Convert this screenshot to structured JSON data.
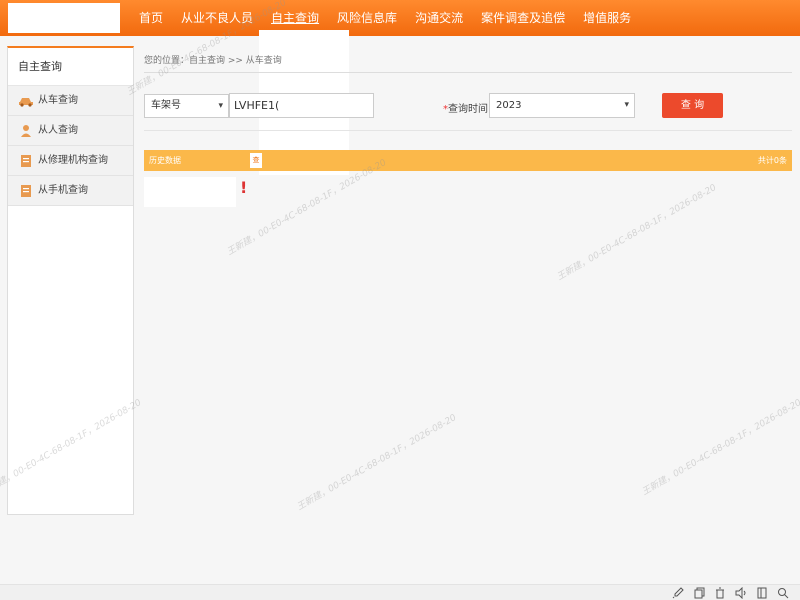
{
  "nav": {
    "items": [
      {
        "label": "首页"
      },
      {
        "label": "从业不良人员"
      },
      {
        "label": "自主查询",
        "active": true
      },
      {
        "label": "风险信息库"
      },
      {
        "label": "沟通交流"
      },
      {
        "label": "案件调查及追偿"
      },
      {
        "label": "增值服务"
      }
    ]
  },
  "sidebar": {
    "title": "自主查询",
    "items": [
      {
        "label": "从车查询",
        "icon": "car-icon"
      },
      {
        "label": "从人查询",
        "icon": "person-icon"
      },
      {
        "label": "从修理机构查询",
        "icon": "document-icon"
      },
      {
        "label": "从手机查询",
        "icon": "document-icon"
      }
    ]
  },
  "breadcrumb": "您的位置：自主查询 >> 从车查询",
  "form": {
    "type_select": "车架号",
    "vin_value": "LVHFE1(",
    "query_time_label": "查询时间:",
    "year_select": "2023",
    "search_label": "查 询"
  },
  "history": {
    "title": "历史数据",
    "tag": "查",
    "count": "共计0条"
  },
  "watermark": "王新建，00-E0-4C-68-08-1F，2026-08-20",
  "colors": {
    "header": "#f26a0e",
    "accent": "#f47c1e",
    "history_bar": "#fbb84a",
    "search_button": "#ec4a2c"
  }
}
